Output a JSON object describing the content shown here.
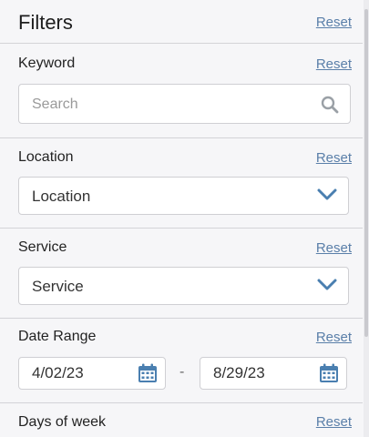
{
  "header": {
    "title": "Filters",
    "reset_label": "Reset"
  },
  "keyword": {
    "label": "Keyword",
    "reset_label": "Reset",
    "placeholder": "Search",
    "icon": "search-icon"
  },
  "location": {
    "label": "Location",
    "reset_label": "Reset",
    "selected": "Location",
    "icon": "chevron-down-icon"
  },
  "service": {
    "label": "Service",
    "reset_label": "Reset",
    "selected": "Service",
    "icon": "chevron-down-icon"
  },
  "date_range": {
    "label": "Date Range",
    "reset_label": "Reset",
    "start": "4/02/23",
    "separator": "-",
    "end": "8/29/23",
    "icon": "calendar-icon"
  },
  "days_of_week": {
    "label": "Days of week",
    "reset_label": "Reset"
  },
  "colors": {
    "accent": "#4a7fb0",
    "reset_link": "#5a7fa9",
    "divider": "#d3d3d7"
  }
}
